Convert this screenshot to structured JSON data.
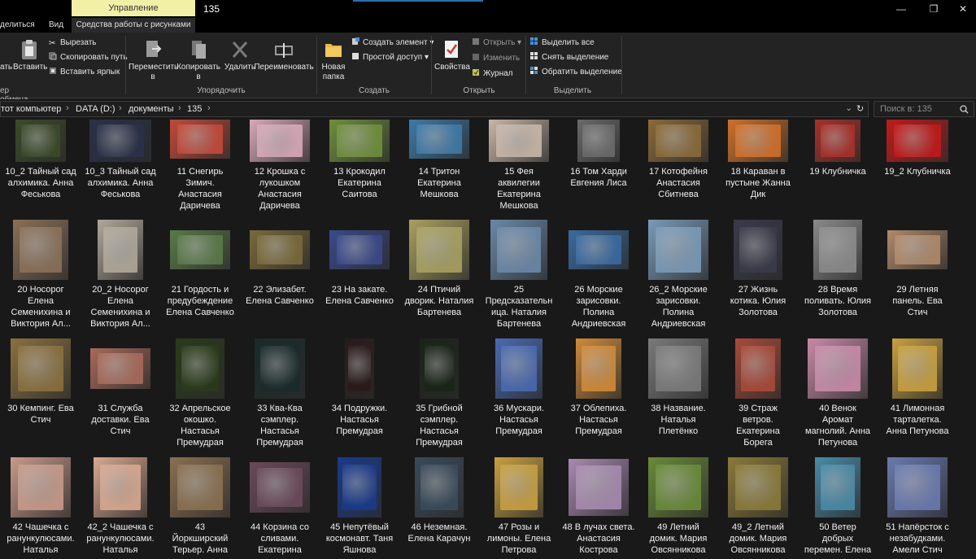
{
  "window": {
    "title": "135",
    "contextual_tab": "Управление",
    "minimize": "—",
    "maximize": "❐",
    "close": "✕"
  },
  "ribbon_tabs": {
    "share": "делиться",
    "view": "Вид",
    "picture_tools": "Средства работы с рисунками"
  },
  "ribbon": {
    "clipboard": {
      "group": "ер обмена",
      "pin_label": "ать",
      "paste": "Вставить",
      "cut": "Вырезать",
      "copy_path": "Скопировать путь",
      "paste_shortcut": "Вставить ярлык"
    },
    "organize": {
      "group": "Упорядочить",
      "move_to": "Переместить",
      "move_to_2": "в",
      "copy_to": "Копировать",
      "copy_to_2": "в",
      "delete": "Удалить",
      "rename": "Переименовать"
    },
    "new": {
      "group": "Создать",
      "new_folder": "Новая",
      "new_folder_2": "папка",
      "new_item": "Создать элемент",
      "easy_access": "Простой доступ"
    },
    "open": {
      "group": "Открыть",
      "properties": "Свойства",
      "open": "Открыть",
      "edit": "Изменить",
      "history": "Журнал"
    },
    "select": {
      "group": "Выделить",
      "select_all": "Выделить все",
      "select_none": "Снять выделение",
      "invert": "Обратить выделение"
    }
  },
  "address": {
    "crumbs": [
      "тот компьютер",
      "DATA (D:)",
      "документы",
      "135"
    ],
    "search_placeholder": "Поиск в: 135"
  },
  "files": [
    {
      "lines": [
        "10_2 Тайный сад",
        "алхимика. Анна",
        "Феськова"
      ],
      "color": "#3b4a2a"
    },
    {
      "lines": [
        "10_3 Тайный сад",
        "алхимика. Анна",
        "Феськова"
      ],
      "color": "#2a3148"
    },
    {
      "lines": [
        "11 Снегирь",
        "Зимич.",
        "Анастасия",
        "Даричева"
      ],
      "color": "#c24a3a"
    },
    {
      "lines": [
        "12 Крошка с",
        "лукошком",
        "Анастасия",
        "Даричева"
      ],
      "color": "#d8a9b8"
    },
    {
      "lines": [
        "13 Крокодил",
        "Екатерина",
        "Саитова"
      ],
      "color": "#6f8f3c"
    },
    {
      "lines": [
        "14 Тритон",
        "Екатерина",
        "Мешкова"
      ],
      "color": "#3f7aa8"
    },
    {
      "lines": [
        "15 Фея",
        "аквилегии",
        "Екатерина",
        "Мешкова"
      ],
      "color": "#c8b7a8"
    },
    {
      "lines": [
        "16 Том Харди",
        "Евгения Лиса"
      ],
      "color": "#6a6a6a"
    },
    {
      "lines": [
        "17 Котофейня",
        "Анастасия",
        "Сбитнева"
      ],
      "color": "#8a6a3a"
    },
    {
      "lines": [
        "18 Караван в",
        "пустыне Жанна",
        "Дик"
      ],
      "color": "#d0702a"
    },
    {
      "lines": [
        "19 Клубничка"
      ],
      "color": "#a8302a"
    },
    {
      "lines": [
        "19_2 Клубничка"
      ],
      "color": "#c01a1a"
    },
    {
      "lines": [
        "20 Носорог",
        "Елена",
        "Семенихина и",
        "Виктория Ал..."
      ],
      "color": "#8a7058"
    },
    {
      "lines": [
        "20_2 Носорог",
        "Елена",
        "Семенихина и",
        "Виктория Ал..."
      ],
      "color": "#b0a89a"
    },
    {
      "lines": [
        "21 Гордость и",
        "предубеждение",
        "Елена Савченко"
      ],
      "color": "#5a7a4a"
    },
    {
      "lines": [
        "22 Элизабет.",
        "Елена Савченко"
      ],
      "color": "#7a6a3a"
    },
    {
      "lines": [
        "23 На закате.",
        "Елена Савченко"
      ],
      "color": "#3a4a8a"
    },
    {
      "lines": [
        "24 Птичий",
        "дворик. Наталия",
        "Бартенева"
      ],
      "color": "#a8a060"
    },
    {
      "lines": [
        "25",
        "Предсказательн",
        "ица. Наталия",
        "Бартенева"
      ],
      "color": "#6a88a8"
    },
    {
      "lines": [
        "26 Морские",
        "зарисовки.",
        "Полина",
        "Андриевская"
      ],
      "color": "#3a6aa0"
    },
    {
      "lines": [
        "26_2 Морские",
        "зарисовки.",
        "Полина",
        "Андриевская"
      ],
      "color": "#7a9ab8"
    },
    {
      "lines": [
        "27 Жизнь",
        "котика. Юлия",
        "Золотова"
      ],
      "color": "#3a3a4a"
    },
    {
      "lines": [
        "28 Время",
        "поливать. Юлия",
        "Золотова"
      ],
      "color": "#8a8a8a"
    },
    {
      "lines": [
        "29 Летняя",
        "панель. Ева",
        "Стич"
      ],
      "color": "#b08a6a"
    },
    {
      "lines": [
        "30 Кемпинг. Ева",
        "Стич"
      ],
      "color": "#8a7040"
    },
    {
      "lines": [
        "31 Служба",
        "доставки. Ева",
        "Стич"
      ],
      "color": "#a86a5a"
    },
    {
      "lines": [
        "32 Апрельское",
        "окошко.",
        "Настасья",
        "Премудрая"
      ],
      "color": "#2a3a1a"
    },
    {
      "lines": [
        "33 Ква-Ква",
        "сэмплер.",
        "Настасья",
        "Премудрая"
      ],
      "color": "#1a2a2a"
    },
    {
      "lines": [
        "34 Подружки.",
        "Настасья",
        "Премудрая"
      ],
      "color": "#2a1a1a"
    },
    {
      "lines": [
        "35 Грибной",
        "сэмплер.",
        "Настасья",
        "Премудрая"
      ],
      "color": "#1a2418"
    },
    {
      "lines": [
        "36 Мускари.",
        "Настасья",
        "Премудрая"
      ],
      "color": "#4a6ab0"
    },
    {
      "lines": [
        "37 Облепиха.",
        "Настасья",
        "Премудрая"
      ],
      "color": "#d08a3a"
    },
    {
      "lines": [
        "38 Название.",
        "Наталья",
        "Плетёнко"
      ],
      "color": "#7a7a7a"
    },
    {
      "lines": [
        "39 Страж",
        "ветров.",
        "Екатерина",
        "Борега"
      ],
      "color": "#a84a3a"
    },
    {
      "lines": [
        "40 Венок",
        "Аромат",
        "магнолий. Анна",
        "Петунова"
      ],
      "color": "#c88aa8"
    },
    {
      "lines": [
        "41 Лимонная",
        "тарталетка.",
        "Анна Петунова"
      ],
      "color": "#c8a040"
    },
    {
      "lines": [
        "42 Чашечка с",
        "ранункулюсами.",
        "Наталья"
      ],
      "color": "#c89a8a"
    },
    {
      "lines": [
        "42_2 Чашечка с",
        "ранункулюсами.",
        "Наталья"
      ],
      "color": "#d8a890"
    },
    {
      "lines": [
        "43",
        "Йоркширский",
        "Терьер. Анна"
      ],
      "color": "#8a7050"
    },
    {
      "lines": [
        "44 Корзина со",
        "сливами.",
        "Екатерина"
      ],
      "color": "#6a4a5a"
    },
    {
      "lines": [
        "45 Непутёвый",
        "космонавт. Таня",
        "Яшнова"
      ],
      "color": "#1a3a8a"
    },
    {
      "lines": [
        "46 Неземная.",
        "Елена Карачун"
      ],
      "color": "#3a4a5a"
    },
    {
      "lines": [
        "47 Розы и",
        "лимоны. Елена",
        "Петрова"
      ],
      "color": "#c8a040"
    },
    {
      "lines": [
        "48 В лучах света.",
        "Анастасия",
        "Кострова"
      ],
      "color": "#a88ab0"
    },
    {
      "lines": [
        "49 Летний",
        "домик. Мария",
        "Овсянникова"
      ],
      "color": "#6a8a3a"
    },
    {
      "lines": [
        "49_2 Летний",
        "домик. Мария",
        "Овсянникова"
      ],
      "color": "#8a7a3a"
    },
    {
      "lines": [
        "50 Ветер",
        "добрых",
        "перемен. Елена"
      ],
      "color": "#4a8aa8"
    },
    {
      "lines": [
        "51 Напёрсток с",
        "незабудками.",
        "Амели Стич"
      ],
      "color": "#6a7ab0"
    }
  ]
}
